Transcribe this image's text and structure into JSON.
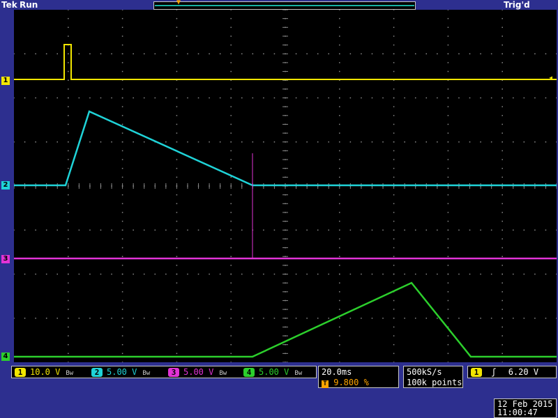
{
  "header": {
    "brand": "Tek",
    "run_state": "Run",
    "trigger_status": "Trig'd"
  },
  "markers": {
    "trigger_position": "T",
    "ch1": "1",
    "ch2": "2",
    "ch3": "3",
    "ch4": "4"
  },
  "channels": [
    {
      "num": "1",
      "scale": "10.0 V",
      "color": "#f2e600"
    },
    {
      "num": "2",
      "scale": "5.00 V",
      "color": "#1fd3d8"
    },
    {
      "num": "3",
      "scale": "5.00 V",
      "color": "#e233d6"
    },
    {
      "num": "4",
      "scale": "5.00 V",
      "color": "#2ccf2c"
    }
  ],
  "bandwidth_symbol": "Bw",
  "timebase": {
    "time_per_div": "20.0ms",
    "trigger_position": "9.800 %"
  },
  "acquisition": {
    "sample_rate": "500kS/s",
    "record_length": "100k points"
  },
  "trigger": {
    "source": "1",
    "slope_symbol": "ʃ",
    "level": "6.20 V"
  },
  "datetime": {
    "date": "12 Feb  2015",
    "time": "11:00:47"
  }
}
